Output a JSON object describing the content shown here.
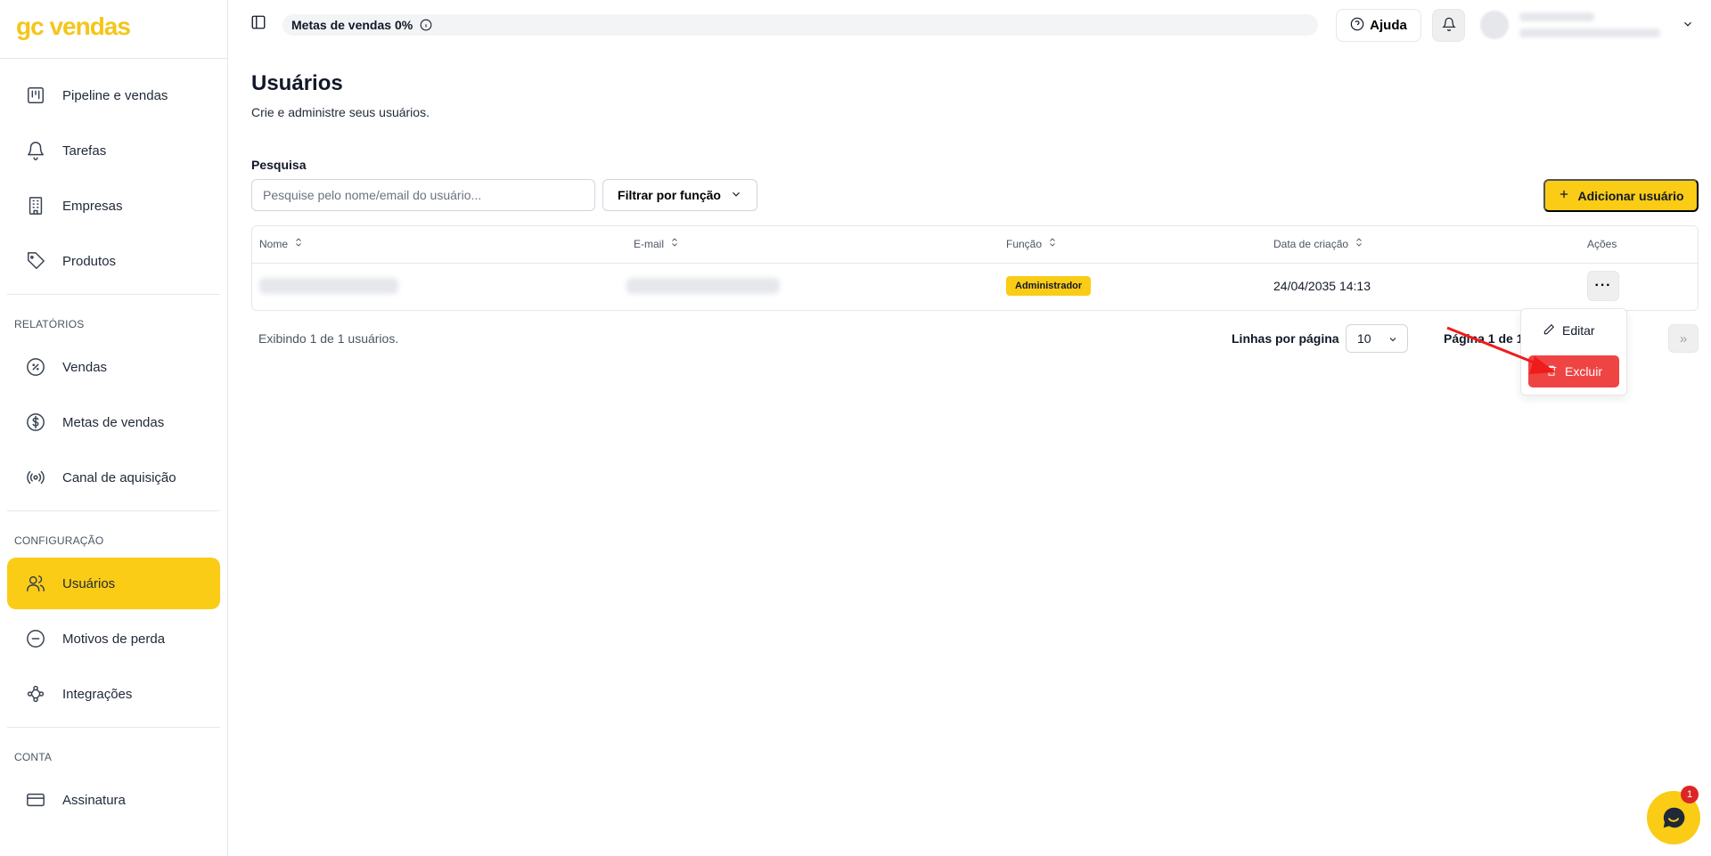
{
  "brand": {
    "logo_text": "gc vendas",
    "accent": "#facc15"
  },
  "sidebar": {
    "main_items": [
      {
        "label": "Pipeline e vendas",
        "icon": "kanban-icon"
      },
      {
        "label": "Tarefas",
        "icon": "bell-icon"
      },
      {
        "label": "Empresas",
        "icon": "building-icon"
      },
      {
        "label": "Produtos",
        "icon": "tag-icon"
      }
    ],
    "reports_title": "RELATÓRIOS",
    "reports_items": [
      {
        "label": "Vendas",
        "icon": "percent-icon"
      },
      {
        "label": "Metas de vendas",
        "icon": "dollar-icon"
      },
      {
        "label": "Canal de aquisição",
        "icon": "broadcast-icon"
      }
    ],
    "config_title": "CONFIGURAÇÃO",
    "config_items": [
      {
        "label": "Usuários",
        "icon": "users-icon",
        "active": true
      },
      {
        "label": "Motivos de perda",
        "icon": "minus-circle-icon"
      },
      {
        "label": "Integrações",
        "icon": "workflow-icon"
      }
    ],
    "account_title": "CONTA",
    "account_items": [
      {
        "label": "Assinatura",
        "icon": "credit-card-icon"
      }
    ]
  },
  "topbar": {
    "goal_text": "Metas de vendas 0%",
    "help_label": "Ajuda"
  },
  "page": {
    "title": "Usuários",
    "subtitle": "Crie e administre seus usuários.",
    "search_label": "Pesquisa",
    "search_placeholder": "Pesquise pelo nome/email do usuário...",
    "filter_label": "Filtrar por função",
    "add_label": "Adicionar usuário"
  },
  "table": {
    "headers": [
      "Nome",
      "E-mail",
      "Função",
      "Data de criação",
      "Ações"
    ],
    "rows": [
      {
        "role": "Administrador",
        "created": "24/04/2035 14:13"
      }
    ],
    "actions_symbol": "···"
  },
  "pagination": {
    "showing": "Exibindo 1 de 1 usuários.",
    "rows_label": "Linhas por página",
    "rows_value": "10",
    "page_info": "Página 1 de 1",
    "last_symbol": "»"
  },
  "action_menu": {
    "edit_label": "Editar",
    "delete_label": "Excluir"
  },
  "chat": {
    "badge": "1"
  }
}
